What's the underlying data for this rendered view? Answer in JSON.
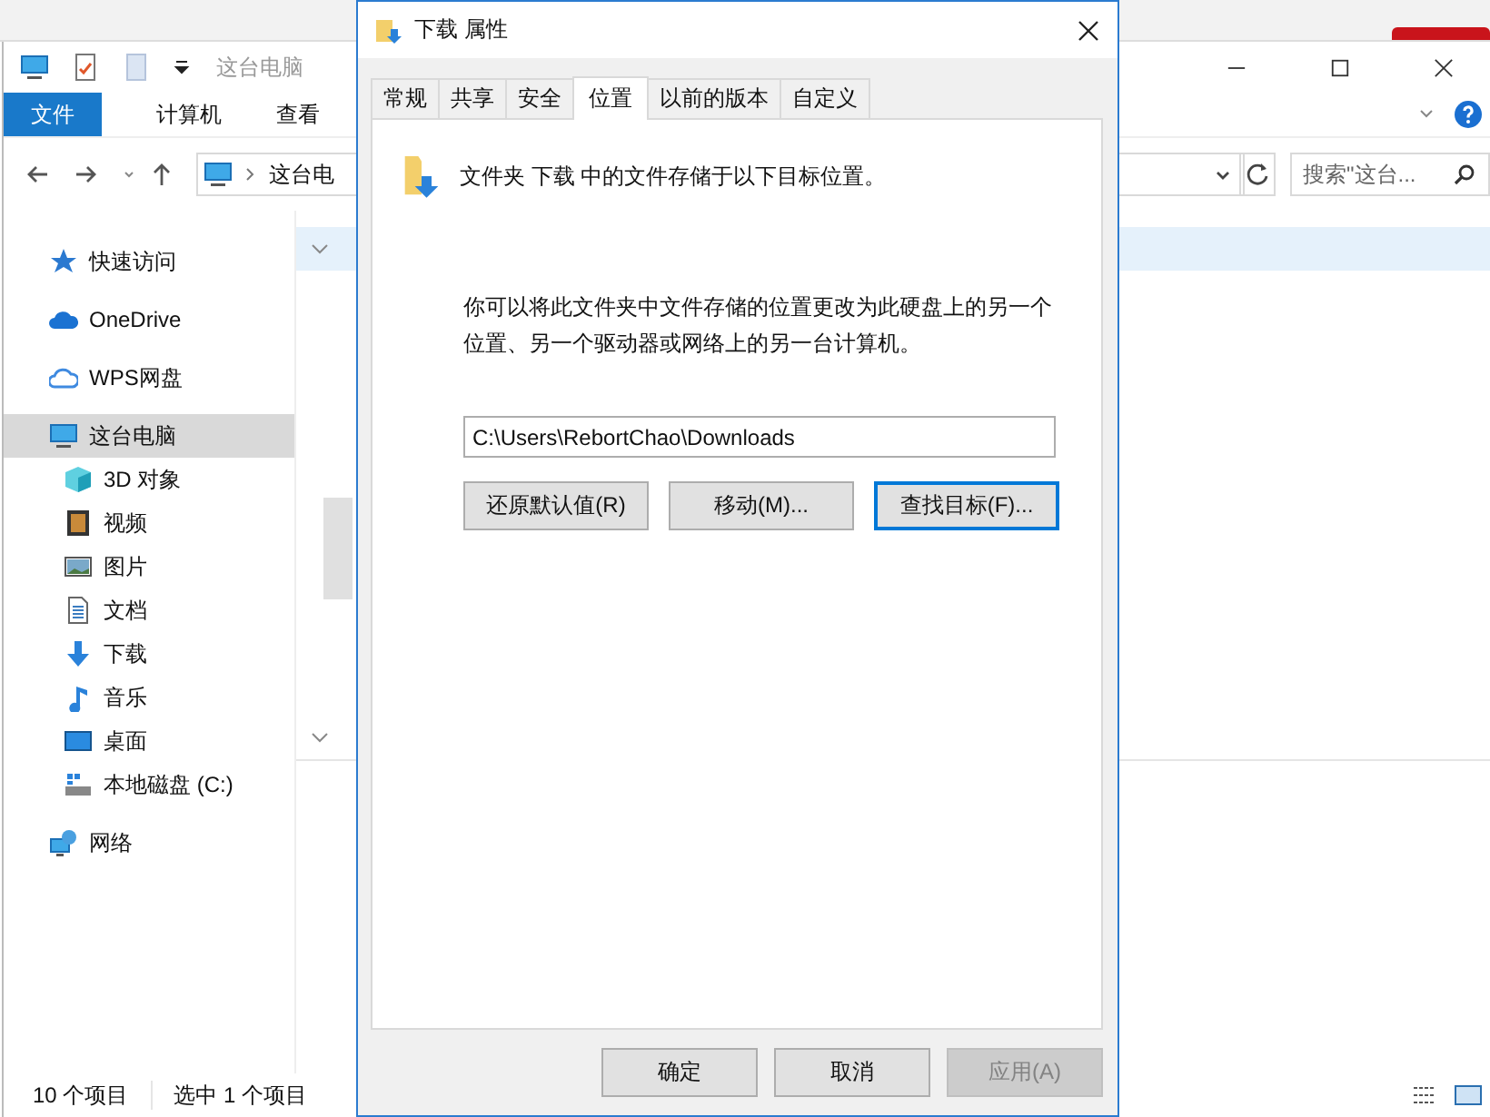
{
  "explorer": {
    "title": "这台电脑",
    "ribbon_tabs": [
      {
        "label": "文件",
        "selected": true
      },
      {
        "label": "计算机",
        "selected": false
      },
      {
        "label": "查看",
        "selected": false
      }
    ],
    "address": "这台电",
    "search": {
      "placeholder": "搜索\"这台..."
    },
    "sidebar": [
      {
        "label": "快速访问",
        "kind": "star",
        "selected": false
      },
      {
        "label": "OneDrive",
        "kind": "cloud",
        "selected": false
      },
      {
        "label": "WPS网盘",
        "kind": "cloud-outline",
        "selected": false
      },
      {
        "label": "这台电脑",
        "kind": "pc",
        "selected": true,
        "children": [
          {
            "label": "3D 对象",
            "kind": "cube",
            "selected": false
          },
          {
            "label": "视频",
            "kind": "film",
            "selected": false
          },
          {
            "label": "图片",
            "kind": "image",
            "selected": false
          },
          {
            "label": "文档",
            "kind": "doc",
            "selected": false
          },
          {
            "label": "下载",
            "kind": "download",
            "selected": false
          },
          {
            "label": "音乐",
            "kind": "note",
            "selected": false
          },
          {
            "label": "桌面",
            "kind": "desktop",
            "selected": false
          },
          {
            "label": "本地磁盘 (C:)",
            "kind": "drive",
            "selected": false
          }
        ]
      },
      {
        "label": "网络",
        "kind": "network",
        "selected": false
      }
    ],
    "status": [
      "10 个项目",
      "选中 1 个项目"
    ]
  },
  "dialog": {
    "title": "下载 属性",
    "tabs": [
      {
        "label": "常规",
        "selected": false
      },
      {
        "label": "共享",
        "selected": false
      },
      {
        "label": "安全",
        "selected": false
      },
      {
        "label": "位置",
        "selected": true
      },
      {
        "label": "以前的版本",
        "selected": false
      },
      {
        "label": "自定义",
        "selected": false
      }
    ],
    "location_text": "文件夹 下载 中的文件存储于以下目标位置。",
    "description": "你可以将此文件夹中文件存储的位置更改为此硬盘上的另一个位置、另一个驱动器或网络上的另一台计算机。",
    "path": "C:\\Users\\RebortChao\\Downloads",
    "actions": [
      {
        "label": "还原默认值(R)",
        "focused": false
      },
      {
        "label": "移动(M)...",
        "focused": false
      },
      {
        "label": "查找目标(F)...",
        "focused": true
      }
    ],
    "buttons": [
      {
        "label": "确定",
        "disabled": false
      },
      {
        "label": "取消",
        "disabled": false
      },
      {
        "label": "应用(A)",
        "disabled": true
      }
    ]
  }
}
